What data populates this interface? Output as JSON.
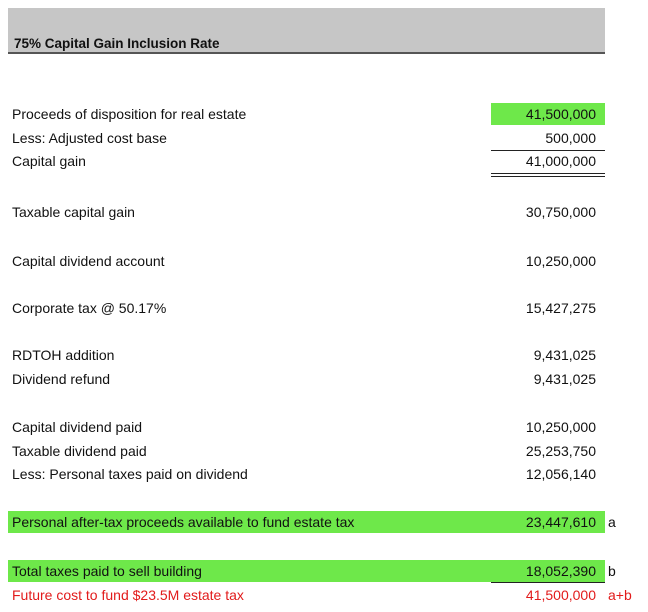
{
  "title": "75% Capital Gain Inclusion Rate",
  "rows": [
    {
      "label": "Proceeds of disposition for real estate",
      "value": "41,500,000",
      "suffix": ""
    },
    {
      "label": "Less: Adjusted cost base",
      "value": "500,000",
      "suffix": ""
    },
    {
      "label": "Capital gain",
      "value": "41,000,000",
      "suffix": ""
    },
    {
      "label": "Taxable capital gain",
      "value": "30,750,000",
      "suffix": ""
    },
    {
      "label": "Capital dividend account",
      "value": "10,250,000",
      "suffix": ""
    },
    {
      "label": "Corporate tax @ 50.17%",
      "value": "15,427,275",
      "suffix": ""
    },
    {
      "label": "RDTOH  addition",
      "value": "9,431,025",
      "suffix": ""
    },
    {
      "label": "Dividend refund",
      "value": "9,431,025",
      "suffix": ""
    },
    {
      "label": "Capital dividend paid",
      "value": "10,250,000",
      "suffix": ""
    },
    {
      "label": "Taxable dividend paid",
      "value": "25,253,750",
      "suffix": ""
    },
    {
      "label": "Less: Personal taxes paid on dividend",
      "value": "12,056,140",
      "suffix": ""
    },
    {
      "label": "Personal after-tax proceeds available to fund estate tax",
      "value": "23,447,610",
      "suffix": "a"
    },
    {
      "label": "Total taxes paid to sell building",
      "value": "18,052,390",
      "suffix": "b"
    },
    {
      "label": "Future cost to fund $23.5M estate tax",
      "value": "41,500,000",
      "suffix": "a+b"
    }
  ],
  "colors": {
    "header_bg": "#c6c6c6",
    "highlight_green": "#6ee84a",
    "accent_red": "#e21b1b"
  }
}
